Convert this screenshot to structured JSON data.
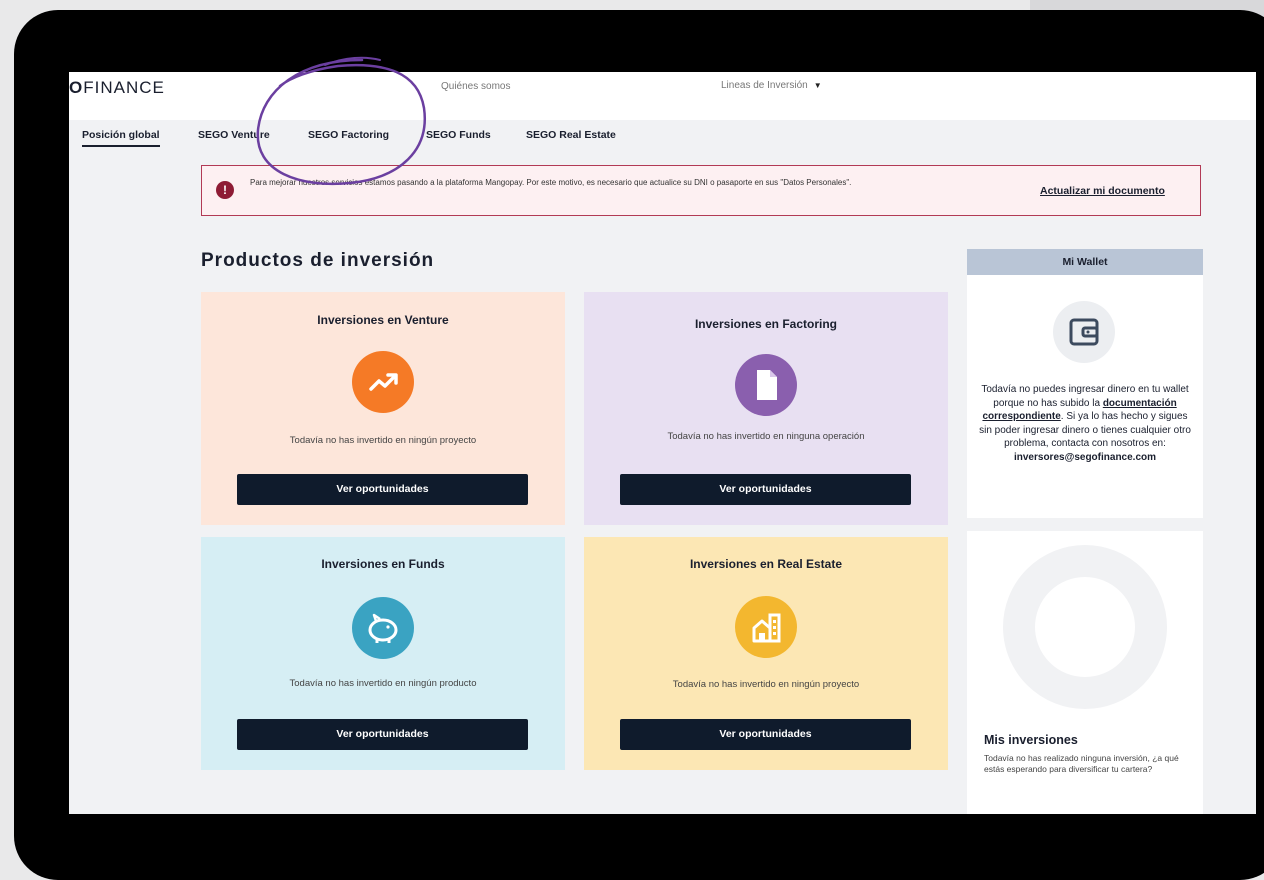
{
  "header": {
    "logo_text": "FINANCE",
    "nav_quienes": "Quiénes somos",
    "nav_lineas": "Lineas de Inversión"
  },
  "tabs": [
    {
      "label": "Posición global",
      "active": true
    },
    {
      "label": "SEGO Venture"
    },
    {
      "label": "SEGO Factoring"
    },
    {
      "label": "SEGO Funds"
    },
    {
      "label": "SEGO Real Estate"
    }
  ],
  "alert": {
    "message": "Para mejorar nuestros servicios estamos pasando a la plataforma Mangopay. Por este motivo, es necesario que actualice su DNI o pasaporte en sus \"Datos Personales\".",
    "link": "Actualizar mi documento"
  },
  "products": {
    "title": "Productos de inversión",
    "cards": [
      {
        "title": "Inversiones en Venture",
        "desc": "Todavía no has invertido en ningún proyecto",
        "button": "Ver oportunidades",
        "bg": "#fde6da",
        "icon_color": "#f57a26",
        "icon": "trend-up-icon"
      },
      {
        "title": "Inversiones en Factoring",
        "desc": "Todavía no has invertido en ninguna operación",
        "button": "Ver oportunidades",
        "bg": "#e8e0f2",
        "icon_color": "#8a5fae",
        "icon": "document-icon"
      },
      {
        "title": "Inversiones en Funds",
        "desc": "Todavía no has invertido en ningún producto",
        "button": "Ver oportunidades",
        "bg": "#d6eef4",
        "icon_color": "#3aa3c2",
        "icon": "piggy-bank-icon"
      },
      {
        "title": "Inversiones en Real Estate",
        "desc": "Todavía no has invertido en ningún proyecto",
        "button": "Ver oportunidades",
        "bg": "#fce7b4",
        "icon_color": "#f3b72f",
        "icon": "building-icon"
      }
    ]
  },
  "wallet": {
    "title": "Mi Wallet",
    "text_1": "Todavía no puedes ingresar dinero en tu wallet porque no has subido la ",
    "text_link": "documentación correspondiente",
    "text_2": ". Si ya lo has hecho y sigues sin poder ingresar dinero o tienes cualquier otro problema, contacta con nosotros en: ",
    "email": "inversores@segofinance.com",
    "icon": "wallet-icon"
  },
  "mis_inversiones": {
    "title": "Mis inversiones",
    "text": "Todavía no has realizado ninguna inversión, ¿a qué estás esperando para diversificar tu cartera?"
  },
  "colors": {
    "navy": "#0f1b2c",
    "alert_border": "#b23a55",
    "annotation": "#6b3fa0"
  }
}
